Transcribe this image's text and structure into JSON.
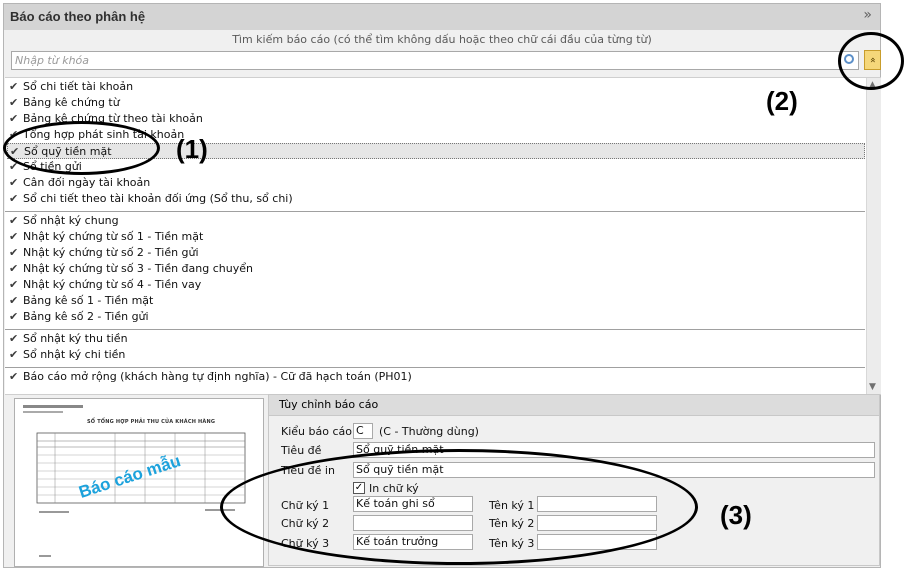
{
  "panel": {
    "title": "Báo cáo theo phân hệ",
    "collapse_glyph": "»"
  },
  "search": {
    "caption": "Tìm kiếm báo cáo (có thể tìm không dấu hoặc theo chữ cái đầu của từng từ)",
    "placeholder": "Nhập từ khóa",
    "collapse_btn_glyph": "«"
  },
  "reports": {
    "group1": [
      "Sổ chi tiết tài khoản",
      "Bảng kê chứng từ",
      "Bảng kê chứng từ theo tài khoản",
      "Tổng hợp phát sinh tài khoản",
      "Sổ quỹ tiền mặt",
      "Sổ tiền gửi",
      "Cân đối ngày tài khoản",
      "Sổ chi tiết theo tài khoản đối ứng (Sổ thu, sổ chi)"
    ],
    "group2": [
      "Sổ nhật ký chung",
      "Nhật ký chứng từ số 1 - Tiền mặt",
      "Nhật ký chứng từ số 2 - Tiền gửi",
      "Nhật ký chứng từ số 3 - Tiền đang chuyển",
      "Nhật ký chứng từ số 4 - Tiền vay",
      "Bảng kê số 1 - Tiền mặt",
      "Bảng kê số 2 - Tiền gửi"
    ],
    "group3": [
      "Sổ nhật ký thu tiền",
      "Sổ nhật ký chi tiền"
    ],
    "group4": [
      "Báo cáo mở rộng (khách hàng tự định nghĩa) - Cữ đã hạch toán (PH01)"
    ]
  },
  "preview": {
    "sample_label": "Báo cáo mẫu",
    "sample_title": "SỔ TỔNG HỢP PHẢI THU CỦA KHÁCH HÀNG"
  },
  "customize": {
    "header": "Tùy chỉnh báo cáo",
    "kieu_label": "Kiểu báo cáo",
    "kieu_value": "C",
    "kieu_desc": "(C - Thường dùng)",
    "tieu_de_label": "Tiêu đề",
    "tieu_de_value": "Sổ quỹ tiền mặt",
    "tieu_de_in_label": "Tiêu đề in",
    "tieu_de_in_value": "Sổ quỹ tiền mặt",
    "in_chu_ky_label": "In chữ ký",
    "chu_ky_1_label": "Chữ ký 1",
    "chu_ky_1_value": "Kế toán ghi sổ",
    "chu_ky_2_label": "Chữ ký 2",
    "chu_ky_2_value": "",
    "chu_ky_3_label": "Chữ ký 3",
    "chu_ky_3_value": "Kế toán trưởng",
    "ten_ky_1_label": "Tên ký 1",
    "ten_ky_2_label": "Tên ký 2",
    "ten_ky_3_label": "Tên ký 3"
  },
  "annotations": {
    "a1": "(1)",
    "a2": "(2)",
    "a3": "(3)"
  }
}
